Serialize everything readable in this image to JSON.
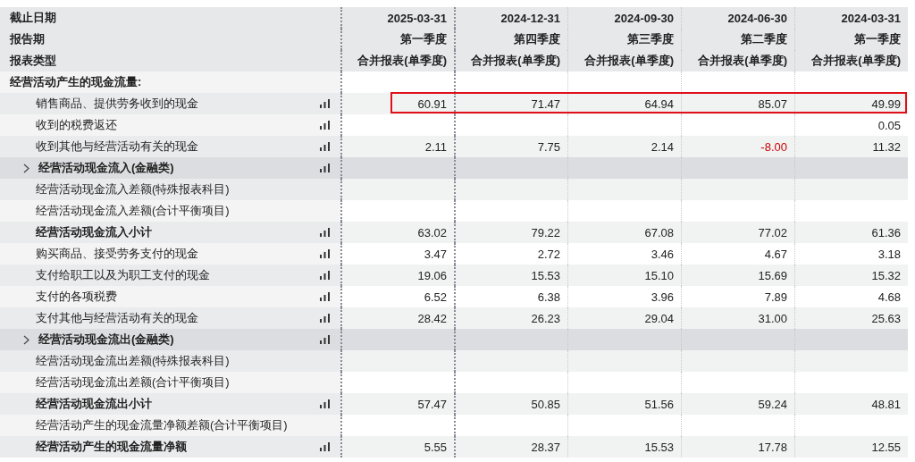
{
  "header": [
    {
      "label": "截止日期",
      "values": [
        "2025-03-31",
        "2024-12-31",
        "2024-09-30",
        "2024-06-30",
        "2024-03-31"
      ]
    },
    {
      "label": "报告期",
      "values": [
        "第一季度",
        "第四季度",
        "第三季度",
        "第二季度",
        "第一季度"
      ]
    },
    {
      "label": "报表类型",
      "values": [
        "合并报表(单季度)",
        "合并报表(单季度)",
        "合并报表(单季度)",
        "合并报表(单季度)",
        "合并报表(单季度)"
      ]
    }
  ],
  "rows": [
    {
      "kind": "section",
      "label": "经营活动产生的现金流量:",
      "chart_icon": false,
      "highlighted": false
    },
    {
      "kind": "item",
      "label": "销售商品、提供劳务收到的现金",
      "chart_icon": true,
      "highlighted": true,
      "values": {
        "c1": "60.91",
        "c2": "71.47",
        "c3": "64.94",
        "c4": "85.07",
        "c5": "49.99"
      }
    },
    {
      "kind": "item",
      "label": "收到的税费返还",
      "chart_icon": true,
      "highlighted": false,
      "values": {
        "c5": "0.05"
      }
    },
    {
      "kind": "item",
      "label": "收到其他与经营活动有关的现金",
      "chart_icon": true,
      "highlighted": false,
      "values": {
        "c1": "2.11",
        "c2": "7.75",
        "c3": "2.14",
        "c4": {
          "text": "-8.00",
          "color": "#cc0000"
        },
        "c5": "11.32"
      }
    },
    {
      "kind": "group",
      "label": "经营活动现金流入(金融类)",
      "expanded": false,
      "chart_icon": true,
      "highlighted": false
    },
    {
      "kind": "item",
      "label": "经营活动现金流入差额(特殊报表科目)",
      "chart_icon": false,
      "highlighted": false
    },
    {
      "kind": "item",
      "label": "经营活动现金流入差额(合计平衡项目)",
      "chart_icon": false,
      "highlighted": false
    },
    {
      "kind": "subtotal",
      "label": "经营活动现金流入小计",
      "chart_icon": true,
      "highlighted": false,
      "values": {
        "c1": "63.02",
        "c2": "79.22",
        "c3": "67.08",
        "c4": "77.02",
        "c5": "61.36"
      }
    },
    {
      "kind": "item",
      "label": "购买商品、接受劳务支付的现金",
      "chart_icon": true,
      "highlighted": false,
      "values": {
        "c1": "3.47",
        "c2": "2.72",
        "c3": "3.46",
        "c4": "4.67",
        "c5": "3.18"
      }
    },
    {
      "kind": "item",
      "label": "支付给职工以及为职工支付的现金",
      "chart_icon": true,
      "highlighted": false,
      "values": {
        "c1": "19.06",
        "c2": "15.53",
        "c3": "15.10",
        "c4": "15.69",
        "c5": "15.32"
      }
    },
    {
      "kind": "item",
      "label": "支付的各项税费",
      "chart_icon": true,
      "highlighted": false,
      "values": {
        "c1": "6.52",
        "c2": "6.38",
        "c3": "3.96",
        "c4": "7.89",
        "c5": "4.68"
      }
    },
    {
      "kind": "item",
      "label": "支付其他与经营活动有关的现金",
      "chart_icon": true,
      "highlighted": false,
      "values": {
        "c1": "28.42",
        "c2": "26.23",
        "c3": "29.04",
        "c4": "31.00",
        "c5": "25.63"
      }
    },
    {
      "kind": "group",
      "label": "经营活动现金流出(金融类)",
      "expanded": false,
      "chart_icon": true,
      "highlighted": false
    },
    {
      "kind": "item",
      "label": "经营活动现金流出差额(特殊报表科目)",
      "chart_icon": false,
      "highlighted": false
    },
    {
      "kind": "item",
      "label": "经营活动现金流出差额(合计平衡项目)",
      "chart_icon": false,
      "highlighted": false
    },
    {
      "kind": "subtotal",
      "label": "经营活动现金流出小计",
      "chart_icon": true,
      "highlighted": false,
      "values": {
        "c1": "57.47",
        "c2": "50.85",
        "c3": "51.56",
        "c4": "59.24",
        "c5": "48.81"
      }
    },
    {
      "kind": "item",
      "label": "经营活动产生的现金流量净额差额(合计平衡项目)",
      "chart_icon": false,
      "highlighted": false
    },
    {
      "kind": "subtotal",
      "label": "经营活动产生的现金流量净额",
      "chart_icon": true,
      "highlighted": false,
      "values": {
        "c1": "5.55",
        "c2": "28.37",
        "c3": "15.53",
        "c4": "17.78",
        "c5": "12.55"
      }
    }
  ]
}
